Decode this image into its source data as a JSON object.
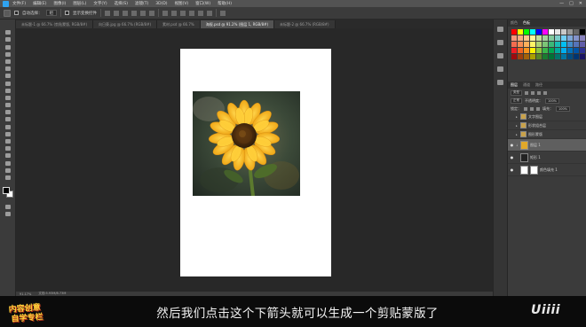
{
  "menubar": {
    "items": [
      "文件(F)",
      "编辑(E)",
      "图像(I)",
      "图层(L)",
      "文字(Y)",
      "选择(S)",
      "滤镜(T)",
      "3D(D)",
      "视图(V)",
      "窗口(W)",
      "帮助(H)"
    ],
    "window_controls": [
      "—",
      "□",
      "✕"
    ]
  },
  "options_bar": {
    "auto_select_label": "自动选择：",
    "target_select": "组",
    "show_transform_label": "显示变换控件"
  },
  "tabs": [
    {
      "label": "未标题-1 @ 66.7% (剪贴蒙版, RGB/8#)",
      "active": false
    },
    {
      "label": "向日葵.jpg @ 66.7% (RGB/8#)",
      "active": false
    },
    {
      "label": "素材.psd @ 66.7%",
      "active": false
    },
    {
      "label": "海报.psd @ 91.2% (图层 1, RGB/8#)",
      "active": true
    },
    {
      "label": "未标题-2 @ 66.7% (RGB/8#)",
      "active": false
    }
  ],
  "status": {
    "zoom": "91.17%",
    "doc": "文档:5.93M/8.73M"
  },
  "right_panel": {
    "swatch_tabs": [
      "颜色",
      "色板"
    ],
    "layers_tabs": [
      "图层",
      "通道",
      "路径"
    ],
    "kind_filter": "类型",
    "blend_mode": "正常",
    "opacity_label": "不透明度：",
    "opacity_value": "100%",
    "lock_label": "锁定：",
    "fill_label": "填充：",
    "fill_value": "100%",
    "layers": [
      {
        "name": "文字图层",
        "type": "group",
        "visible": false,
        "selected": false
      },
      {
        "name": "形状组合层",
        "type": "group",
        "visible": false,
        "selected": false
      },
      {
        "name": "图形蒙版",
        "type": "group",
        "visible": false,
        "selected": false
      },
      {
        "name": "图层 1",
        "type": "image",
        "visible": true,
        "selected": true
      },
      {
        "name": "矩形 1",
        "type": "shape",
        "visible": true,
        "selected": false
      },
      {
        "name": "颜色填充 1",
        "type": "fill",
        "visible": true,
        "selected": false
      }
    ]
  },
  "caption": {
    "subtitle": "然后我们点击这个下箭头就可以生成一个剪贴蒙版了",
    "badge_line1": "内容创意",
    "badge_line2": "自学专栏",
    "watermark": "Uiiii"
  },
  "colors": {
    "menubar_bg": "#535353",
    "panel_bg": "#3b3b3b",
    "workspace_bg": "#282828",
    "accent": "#2fa3f0"
  }
}
